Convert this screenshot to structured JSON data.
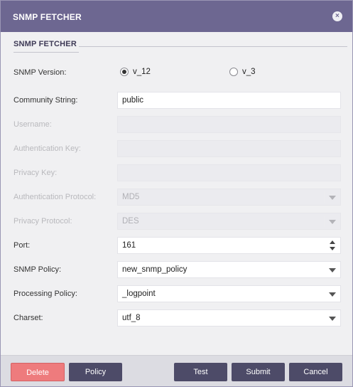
{
  "dialog": {
    "title": "SNMP FETCHER",
    "close_icon": "×"
  },
  "section": {
    "heading": "SNMP FETCHER"
  },
  "form": {
    "snmp_version": {
      "label": "SNMP Version:",
      "options": [
        {
          "label": "v_12",
          "selected": true
        },
        {
          "label": "v_3",
          "selected": false
        }
      ]
    },
    "community_string": {
      "label": "Community String:",
      "value": "public"
    },
    "username": {
      "label": "Username:",
      "value": ""
    },
    "authentication_key": {
      "label": "Authentication Key:",
      "value": ""
    },
    "privacy_key": {
      "label": "Privacy Key:",
      "value": ""
    },
    "authentication_protocol": {
      "label": "Authentication Protocol:",
      "value": "MD5"
    },
    "privacy_protocol": {
      "label": "Privacy Protocol:",
      "value": "DES"
    },
    "port": {
      "label": "Port:",
      "value": "161"
    },
    "snmp_policy": {
      "label": "SNMP Policy:",
      "value": "new_snmp_policy"
    },
    "processing_policy": {
      "label": "Processing Policy:",
      "value": "_logpoint"
    },
    "charset": {
      "label": "Charset:",
      "value": "utf_8"
    }
  },
  "footer": {
    "delete_label": "Delete",
    "policy_label": "Policy",
    "test_label": "Test",
    "submit_label": "Submit",
    "cancel_label": "Cancel"
  },
  "colors": {
    "titlebar": "#6d6791",
    "button_dark": "#4d4b68",
    "button_danger": "#ee7b7d"
  }
}
